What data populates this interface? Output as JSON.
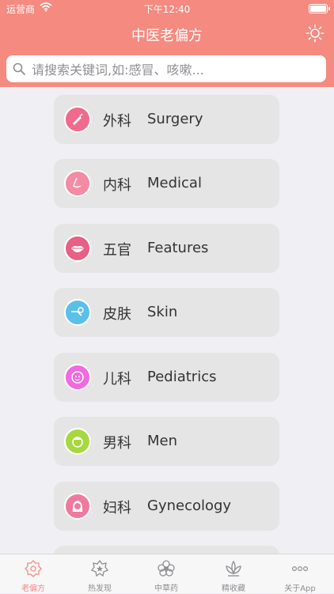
{
  "status_bar": {
    "carrier": "运营商",
    "time": "下午12:40"
  },
  "nav": {
    "title": "中医老偏方",
    "settings_icon": "gear-icon"
  },
  "search": {
    "placeholder": "请搜索关键词,如:感冒、咳嗽..."
  },
  "categories": [
    {
      "zh": "外科",
      "en": "Surgery",
      "icon": "scalpel-icon",
      "color": "#f06a8e"
    },
    {
      "zh": "内科",
      "en": "Medical",
      "icon": "nose-icon",
      "color": "#f48aa4"
    },
    {
      "zh": "五官",
      "en": "Features",
      "icon": "lips-icon",
      "color": "#e86084"
    },
    {
      "zh": "皮肤",
      "en": "Skin",
      "icon": "skin-tool-icon",
      "color": "#5bc0e8"
    },
    {
      "zh": "儿科",
      "en": "Pediatrics",
      "icon": "baby-icon",
      "color": "#f06ae0"
    },
    {
      "zh": "男科",
      "en": "Men",
      "icon": "man-icon",
      "color": "#a8d840"
    },
    {
      "zh": "妇科",
      "en": "Gynecology",
      "icon": "woman-icon",
      "color": "#f07a9e"
    }
  ],
  "tabs": [
    {
      "label": "老偏方",
      "icon": "flower-badge-icon",
      "active": true
    },
    {
      "label": "热发现",
      "icon": "star-flower-icon",
      "active": false
    },
    {
      "label": "中草药",
      "icon": "herb-flower-icon",
      "active": false
    },
    {
      "label": "精收藏",
      "icon": "lotus-icon",
      "active": false
    },
    {
      "label": "关于App",
      "icon": "more-dots-icon",
      "active": false
    }
  ],
  "colors": {
    "accent": "#f48a80",
    "background": "#efeff4",
    "card": "#e5e5e5"
  }
}
